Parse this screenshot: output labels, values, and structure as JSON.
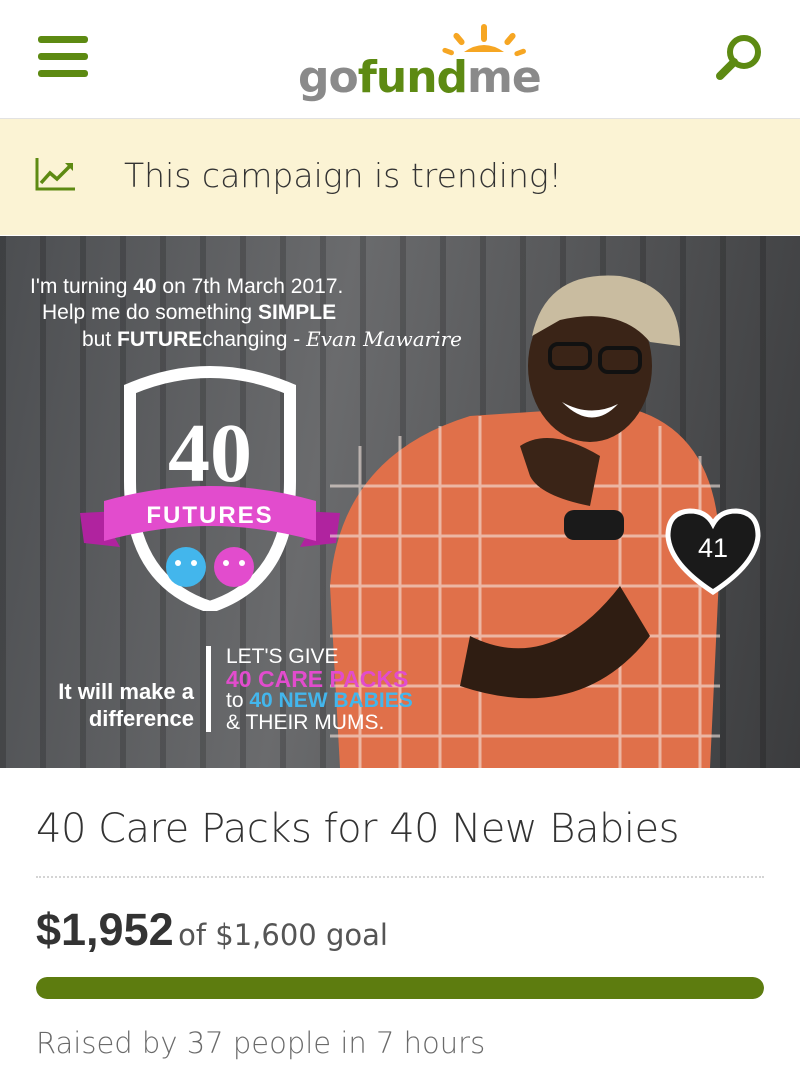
{
  "header": {
    "logo": {
      "go": "go",
      "fund": "fund",
      "me": "me"
    },
    "menu_icon": "hamburger-menu-icon",
    "search_icon": "search-icon",
    "brand_color": "#5d8a12"
  },
  "trending": {
    "text": "This campaign is trending!",
    "icon": "trending-chart-icon",
    "background": "#fbf3d4"
  },
  "hero": {
    "quote_line1_a": "I'm turning ",
    "quote_line1_b": "40",
    "quote_line1_c": " on 7th March 2017.",
    "quote_line2_a": "Help me do something ",
    "quote_line2_b": "SIMPLE",
    "quote_line3_a": "but ",
    "quote_line3_b": "FUTURE",
    "quote_line3_c": "changing - ",
    "signature": "Evan Mawarire",
    "badge_number": "40",
    "badge_ribbon": "FUTURES",
    "left_line1": "It will make a",
    "left_line2": "difference",
    "right_line1": "LET'S GIVE",
    "right_line2": "40 CARE PACKS",
    "right_line3_a": "to ",
    "right_line3_b": "40 NEW BABIES",
    "right_line4": "& THEIR MUMS.",
    "heart_count": "41",
    "heart_icon": "heart-icon"
  },
  "campaign": {
    "title": "40 Care Packs for 40 New Babies",
    "raised": "$1,952",
    "goal_text": "of $1,600 goal",
    "progress_fraction": 1.0,
    "progress_color": "#5d7c0f",
    "raised_by": "Raised by 37 people in 7 hours"
  }
}
